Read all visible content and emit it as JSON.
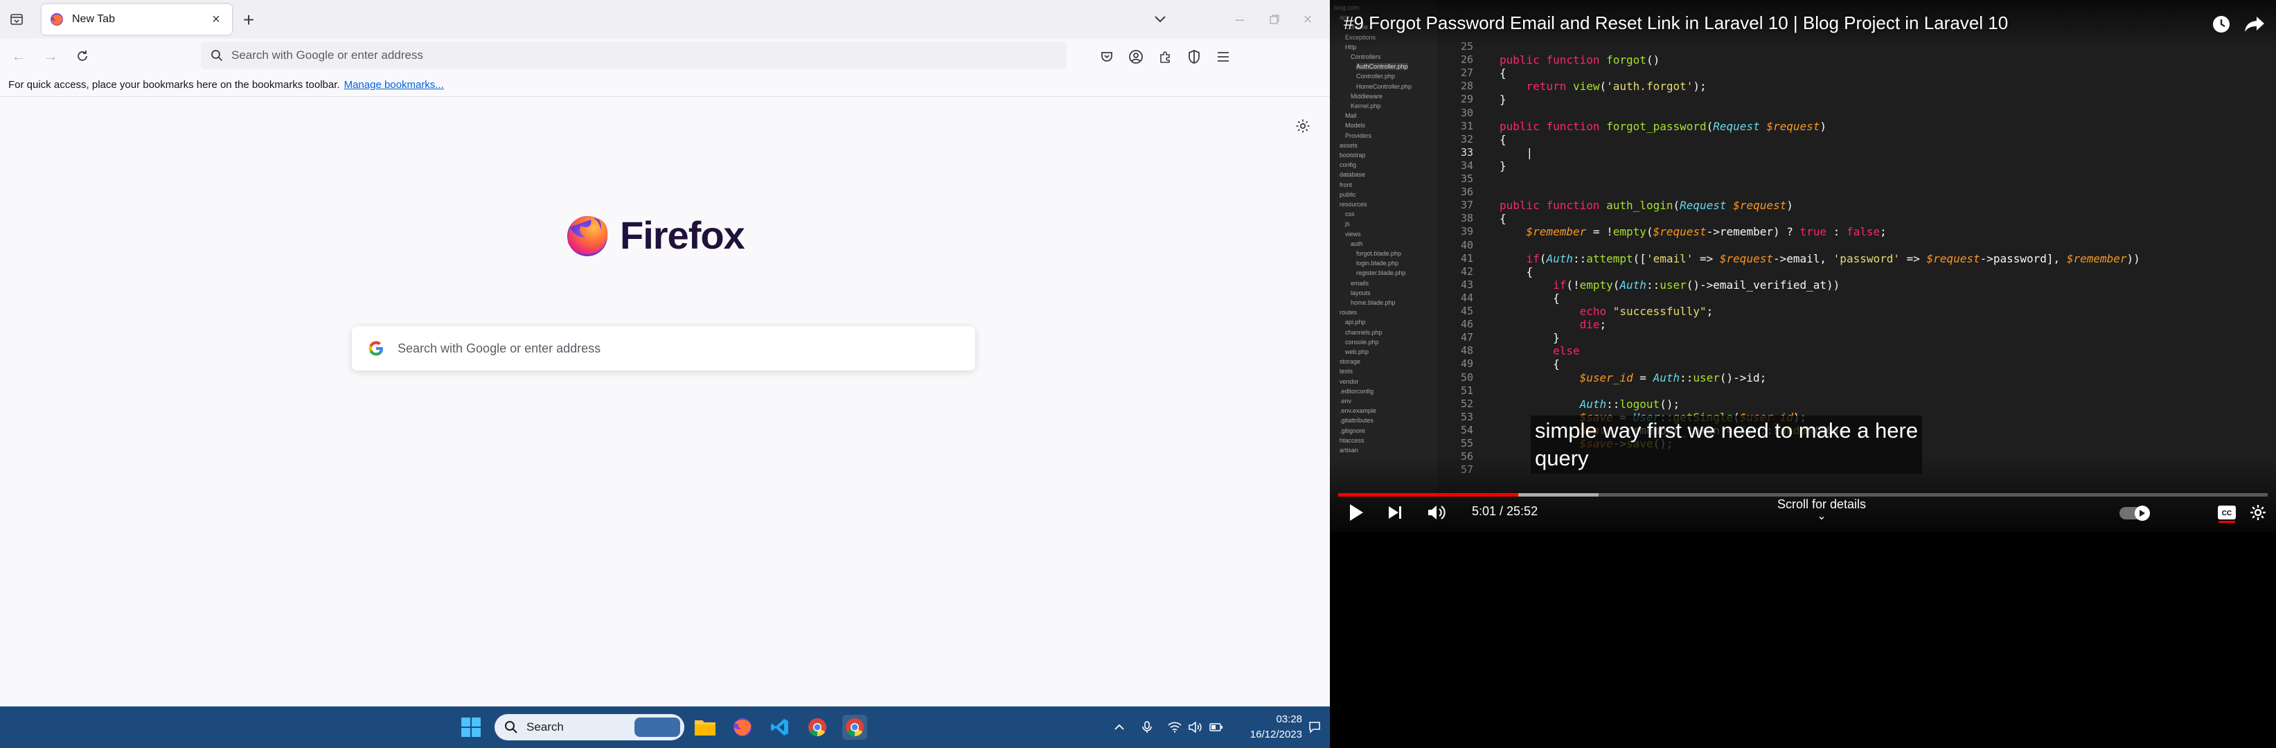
{
  "firefox": {
    "tab": {
      "title": "New Tab"
    },
    "urlbar": {
      "placeholder": "Search with Google or enter address"
    },
    "bookmarks": {
      "message": "For quick access, place your bookmarks here on the bookmarks toolbar.",
      "link": "Manage bookmarks..."
    },
    "brand": "Firefox",
    "search": {
      "placeholder": "Search with Google or enter address"
    },
    "icons": [
      "tabs-menu-icon",
      "firefox-favicon",
      "close-icon",
      "plus-icon",
      "chevron-down-icon",
      "minimize-icon",
      "maximize-icon",
      "close-window-icon",
      "back-arrow-icon",
      "forward-arrow-icon",
      "reload-icon",
      "search-icon",
      "pocket-icon",
      "account-icon",
      "extensions-icon",
      "shield-icon",
      "hamburger-menu-icon",
      "gear-icon",
      "google-icon"
    ]
  },
  "taskbar": {
    "search_label": "Search",
    "time": "03:28",
    "date": "16/12/2023",
    "apps": [
      "windows-start",
      "file-explorer",
      "firefox",
      "vscode",
      "chrome",
      "chrome-profile"
    ]
  },
  "youtube": {
    "title": "#9 Forgot Password Email and Reset Link in Laravel 10 | Blog Project in Laravel 10",
    "time": "5:01 / 25:52",
    "played_fraction": 0.194,
    "loaded_fraction": 0.28,
    "scroll_hint": "Scroll for details",
    "caption_lines": [
      "simple way first we need to make a here",
      "query"
    ],
    "editor": {
      "tree": [
        "blog.com",
        "app",
        "Console",
        "Exceptions",
        "Http",
        "Controllers",
        "AuthController.php",
        "Controller.php",
        "HomeController.php",
        "Middleware",
        "Kernel.php",
        "Mail",
        "Models",
        "Providers",
        "assets",
        "bootstrap",
        "config",
        "database",
        "front",
        "public",
        "resources",
        "css",
        "js",
        "views",
        "auth",
        "forgot.blade.php",
        "login.blade.php",
        "register.blade.php",
        "emails",
        "layouts",
        "home.blade.php",
        "routes",
        "api.php",
        "channels.php",
        "console.php",
        "web.php",
        "storage",
        "tests",
        "vendor",
        ".editorconfig",
        ".env",
        ".env.example",
        ".gitattributes",
        ".gitignore",
        "htaccess",
        "artisan"
      ],
      "line_numbers": [
        "25",
        "26",
        "27",
        "28",
        "29",
        "30",
        "31",
        "32",
        "33",
        "34",
        "35",
        "36",
        "37",
        "38",
        "39",
        "40",
        "41",
        "42",
        "43",
        "44",
        "45",
        "46",
        "47",
        "48",
        "49",
        "50",
        "51",
        "52",
        "53",
        "54",
        "55",
        "56",
        "57"
      ],
      "code_lines": [
        "",
        "public function forgot()",
        "{",
        "    return view('auth.forgot');",
        "}",
        "",
        "public function forgot_password(Request $request)",
        "{",
        "    |",
        "}",
        "",
        "",
        "public function auth_login(Request $request)",
        "{",
        "    $remember = !empty($request->remember) ? true : false;",
        "",
        "    if(Auth::attempt(['email' => $request->email, 'password' => $request->password], $remember))",
        "    {",
        "        if(!empty(Auth::user()->email_verified_at))",
        "        {",
        "            echo \"successfully\";",
        "            die;",
        "        }",
        "        else",
        "        {",
        "            $user_id = Auth::user()->id;",
        "",
        "            Auth::logout();",
        "            $save = User::getSingle($user_id);",
        "            $save->remember_token = Str::random(40);",
        "            $save->save();",
        "",
        ""
      ]
    }
  }
}
